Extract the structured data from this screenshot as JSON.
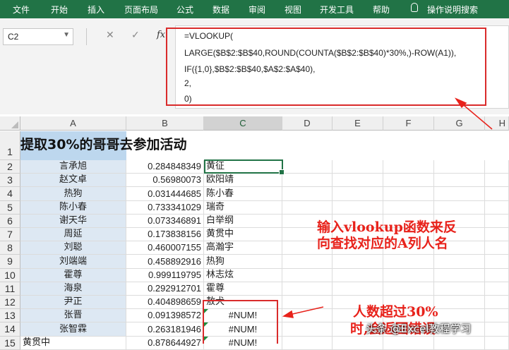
{
  "menu": {
    "tabs": [
      "文件",
      "开始",
      "插入",
      "页面布局",
      "公式",
      "数据",
      "审阅",
      "视图",
      "开发工具",
      "帮助"
    ],
    "search": "操作说明搜索"
  },
  "formula_bar": {
    "name_box": "C2",
    "fx_label": "fx",
    "cancel_icon": "✕",
    "enter_icon": "✓",
    "lines": [
      "=VLOOKUP(",
      "LARGE($B$2:$B$40,ROUND(COUNTA($B$2:$B$40)*30%,)-ROW(A1)),",
      "IF({1,0},$B$2:$B$40,$A$2:$A$40),",
      "2,",
      "0)"
    ]
  },
  "columns": [
    "A",
    "B",
    "C",
    "D",
    "E",
    "F",
    "G",
    "H"
  ],
  "title": "提取30%的哥哥去参加活动",
  "rows": [
    {
      "num": "1"
    },
    {
      "num": "2",
      "a": "言承旭",
      "b": "0.284848349",
      "c": "黄征"
    },
    {
      "num": "3",
      "a": "赵文卓",
      "b": "0.56980073",
      "c": "欧阳靖"
    },
    {
      "num": "4",
      "a": "热狗",
      "b": "0.031444685",
      "c": "陈小春"
    },
    {
      "num": "5",
      "a": "陈小春",
      "b": "0.733341029",
      "c": "瑞奇"
    },
    {
      "num": "6",
      "a": "谢天华",
      "b": "0.073346891",
      "c": "白举纲"
    },
    {
      "num": "7",
      "a": "周延",
      "b": "0.173838156",
      "c": "黄贯中"
    },
    {
      "num": "8",
      "a": "刘聪",
      "b": "0.460007155",
      "c": "高瀚宇"
    },
    {
      "num": "9",
      "a": "刘端端",
      "b": "0.458892916",
      "c": "热狗"
    },
    {
      "num": "10",
      "a": "霍尊",
      "b": "0.999119795",
      "c": "林志炫"
    },
    {
      "num": "11",
      "a": "海泉",
      "b": "0.292912701",
      "c": "霍尊"
    },
    {
      "num": "12",
      "a": "尹正",
      "b": "0.404898659",
      "c": "敖犬"
    },
    {
      "num": "13",
      "a": "张晋",
      "b": "0.091398572",
      "c": "#NUM!"
    },
    {
      "num": "14",
      "a": "张智霖",
      "b": "0.263181946",
      "c": "#NUM!"
    },
    {
      "num": "15",
      "a": "黄贯中",
      "b": "0.878644927",
      "c": "#NUM!"
    }
  ],
  "annotations": {
    "vlookup_note": [
      "输入vlookup函数来反",
      "向查找对应的A列人名"
    ],
    "over_note": [
      "人数超过30%",
      "时,会返回错误"
    ]
  },
  "watermark": "头条 @Excel教程学习",
  "colors": {
    "ribbon": "#217346",
    "annotation_red": "#e8221b",
    "column_a_fill": "#dde8f3",
    "title_fill": "#bdd7ee"
  }
}
